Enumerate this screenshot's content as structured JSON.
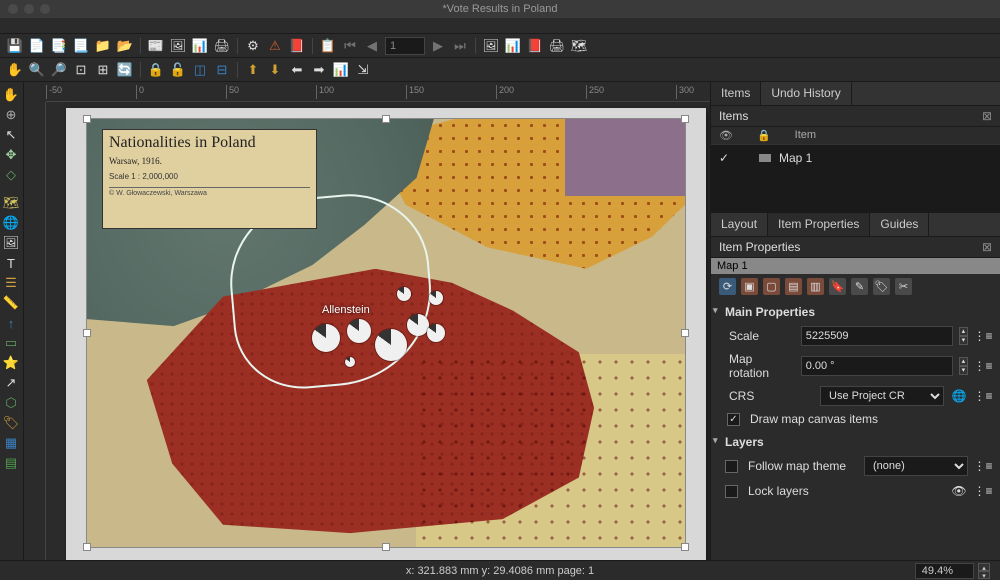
{
  "window": {
    "title": "*Vote Results in Poland"
  },
  "toolbar": {
    "page_num": "1"
  },
  "ruler": {
    "marks": [
      "-50",
      "0",
      "50",
      "100",
      "150",
      "200",
      "250",
      "300"
    ]
  },
  "canvas": {
    "legend_title": "Nationalities in Poland",
    "legend_sub": "Warsaw, 1916.",
    "marker_label": "Allenstein"
  },
  "panel": {
    "tabs_top": {
      "items": "Items",
      "undo": "Undo History"
    },
    "items_header": "Items",
    "col_vis": "👁",
    "col_lock": "🔒",
    "col_item": "Item",
    "rows": [
      {
        "name": "Map 1"
      }
    ],
    "tabs_mid": {
      "layout": "Layout",
      "props": "Item Properties",
      "guides": "Guides"
    },
    "props_header": "Item Properties",
    "selected": "Map 1",
    "section_main": "Main Properties",
    "scale_lbl": "Scale",
    "scale_val": "5225509",
    "rot_lbl": "Map rotation",
    "rot_val": "0.00 °",
    "crs_lbl": "CRS",
    "crs_val": "Use Project CR",
    "draw_canvas": "Draw map canvas items",
    "section_layers": "Layers",
    "follow_lbl": "Follow map theme",
    "follow_val": "(none)",
    "lock_lbl": "Lock layers"
  },
  "status": {
    "coords": "x: 321.883 mm y: 29.4086 mm page: 1",
    "zoom": "49.4%"
  }
}
